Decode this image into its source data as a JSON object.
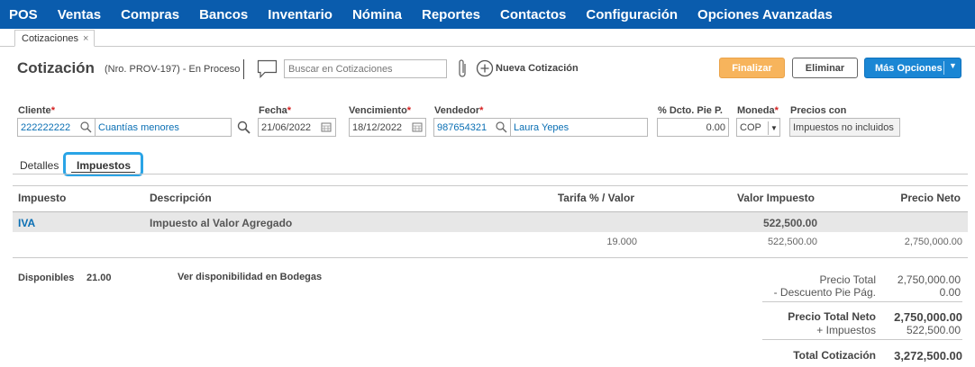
{
  "nav": [
    "POS",
    "Ventas",
    "Compras",
    "Bancos",
    "Inventario",
    "Nómina",
    "Reportes",
    "Contactos",
    "Configuración",
    "Opciones Avanzadas"
  ],
  "doc_tab": {
    "label": "Cotizaciones",
    "close": "×"
  },
  "header": {
    "title": "Cotización",
    "info": "(Nro. PROV-197) - En Proceso",
    "search_placeholder": "Buscar en Cotizaciones",
    "new_quote": "Nueva Cotización"
  },
  "buttons": {
    "finalizar": "Finalizar",
    "eliminar": "Eliminar",
    "mas": "Más Opciones"
  },
  "form": {
    "cliente": {
      "label": "Cliente",
      "code": "222222222",
      "name": "Cuantías menores"
    },
    "fecha": {
      "label": "Fecha",
      "value": "21/06/2022"
    },
    "vencimiento": {
      "label": "Vencimiento",
      "value": "18/12/2022"
    },
    "vendedor": {
      "label": "Vendedor",
      "code": "987654321",
      "name": "Laura Yepes"
    },
    "dcto": {
      "label": "% Dcto. Pie P.",
      "value": "0.00"
    },
    "moneda": {
      "label": "Moneda",
      "value": "COP"
    },
    "precios": {
      "label": "Precios con",
      "value": "Impuestos no incluidos"
    }
  },
  "tabs": {
    "detalles": "Detalles",
    "impuestos": "Impuestos"
  },
  "table": {
    "headers": {
      "impuesto": "Impuesto",
      "descripcion": "Descripción",
      "tarifa": "Tarifa % / Valor",
      "valor": "Valor Impuesto",
      "neto": "Precio Neto"
    },
    "row": {
      "impuesto": "IVA",
      "descripcion": "Impuesto al Valor Agregado",
      "valor": "522,500.00"
    },
    "summary": {
      "tarifa": "19.000",
      "valor": "522,500.00",
      "neto": "2,750,000.00"
    }
  },
  "footer": {
    "disponibles_label": "Disponibles",
    "disponibles_value": "21.00",
    "bodegas_link": "Ver disponibilidad en Bodegas",
    "precio_total_label": "Precio Total",
    "precio_total_value": "2,750,000.00",
    "descuento_label": "- Descuento Pie Pág.",
    "descuento_value": "0.00",
    "precio_neto_label": "Precio Total Neto",
    "precio_neto_value": "2,750,000.00",
    "impuestos_label": "+ Impuestos",
    "impuestos_value": "522,500.00",
    "total_label": "Total Cotización",
    "total_value": "3,272,500.00"
  },
  "colors": {
    "nav_bg": "#0a5cad",
    "finalizar": "#f7b45c",
    "mas_opciones": "#1a86d4",
    "link": "#0a6fb4",
    "active_tab_outline": "#2aa4e6",
    "required": "#d41e1e"
  }
}
